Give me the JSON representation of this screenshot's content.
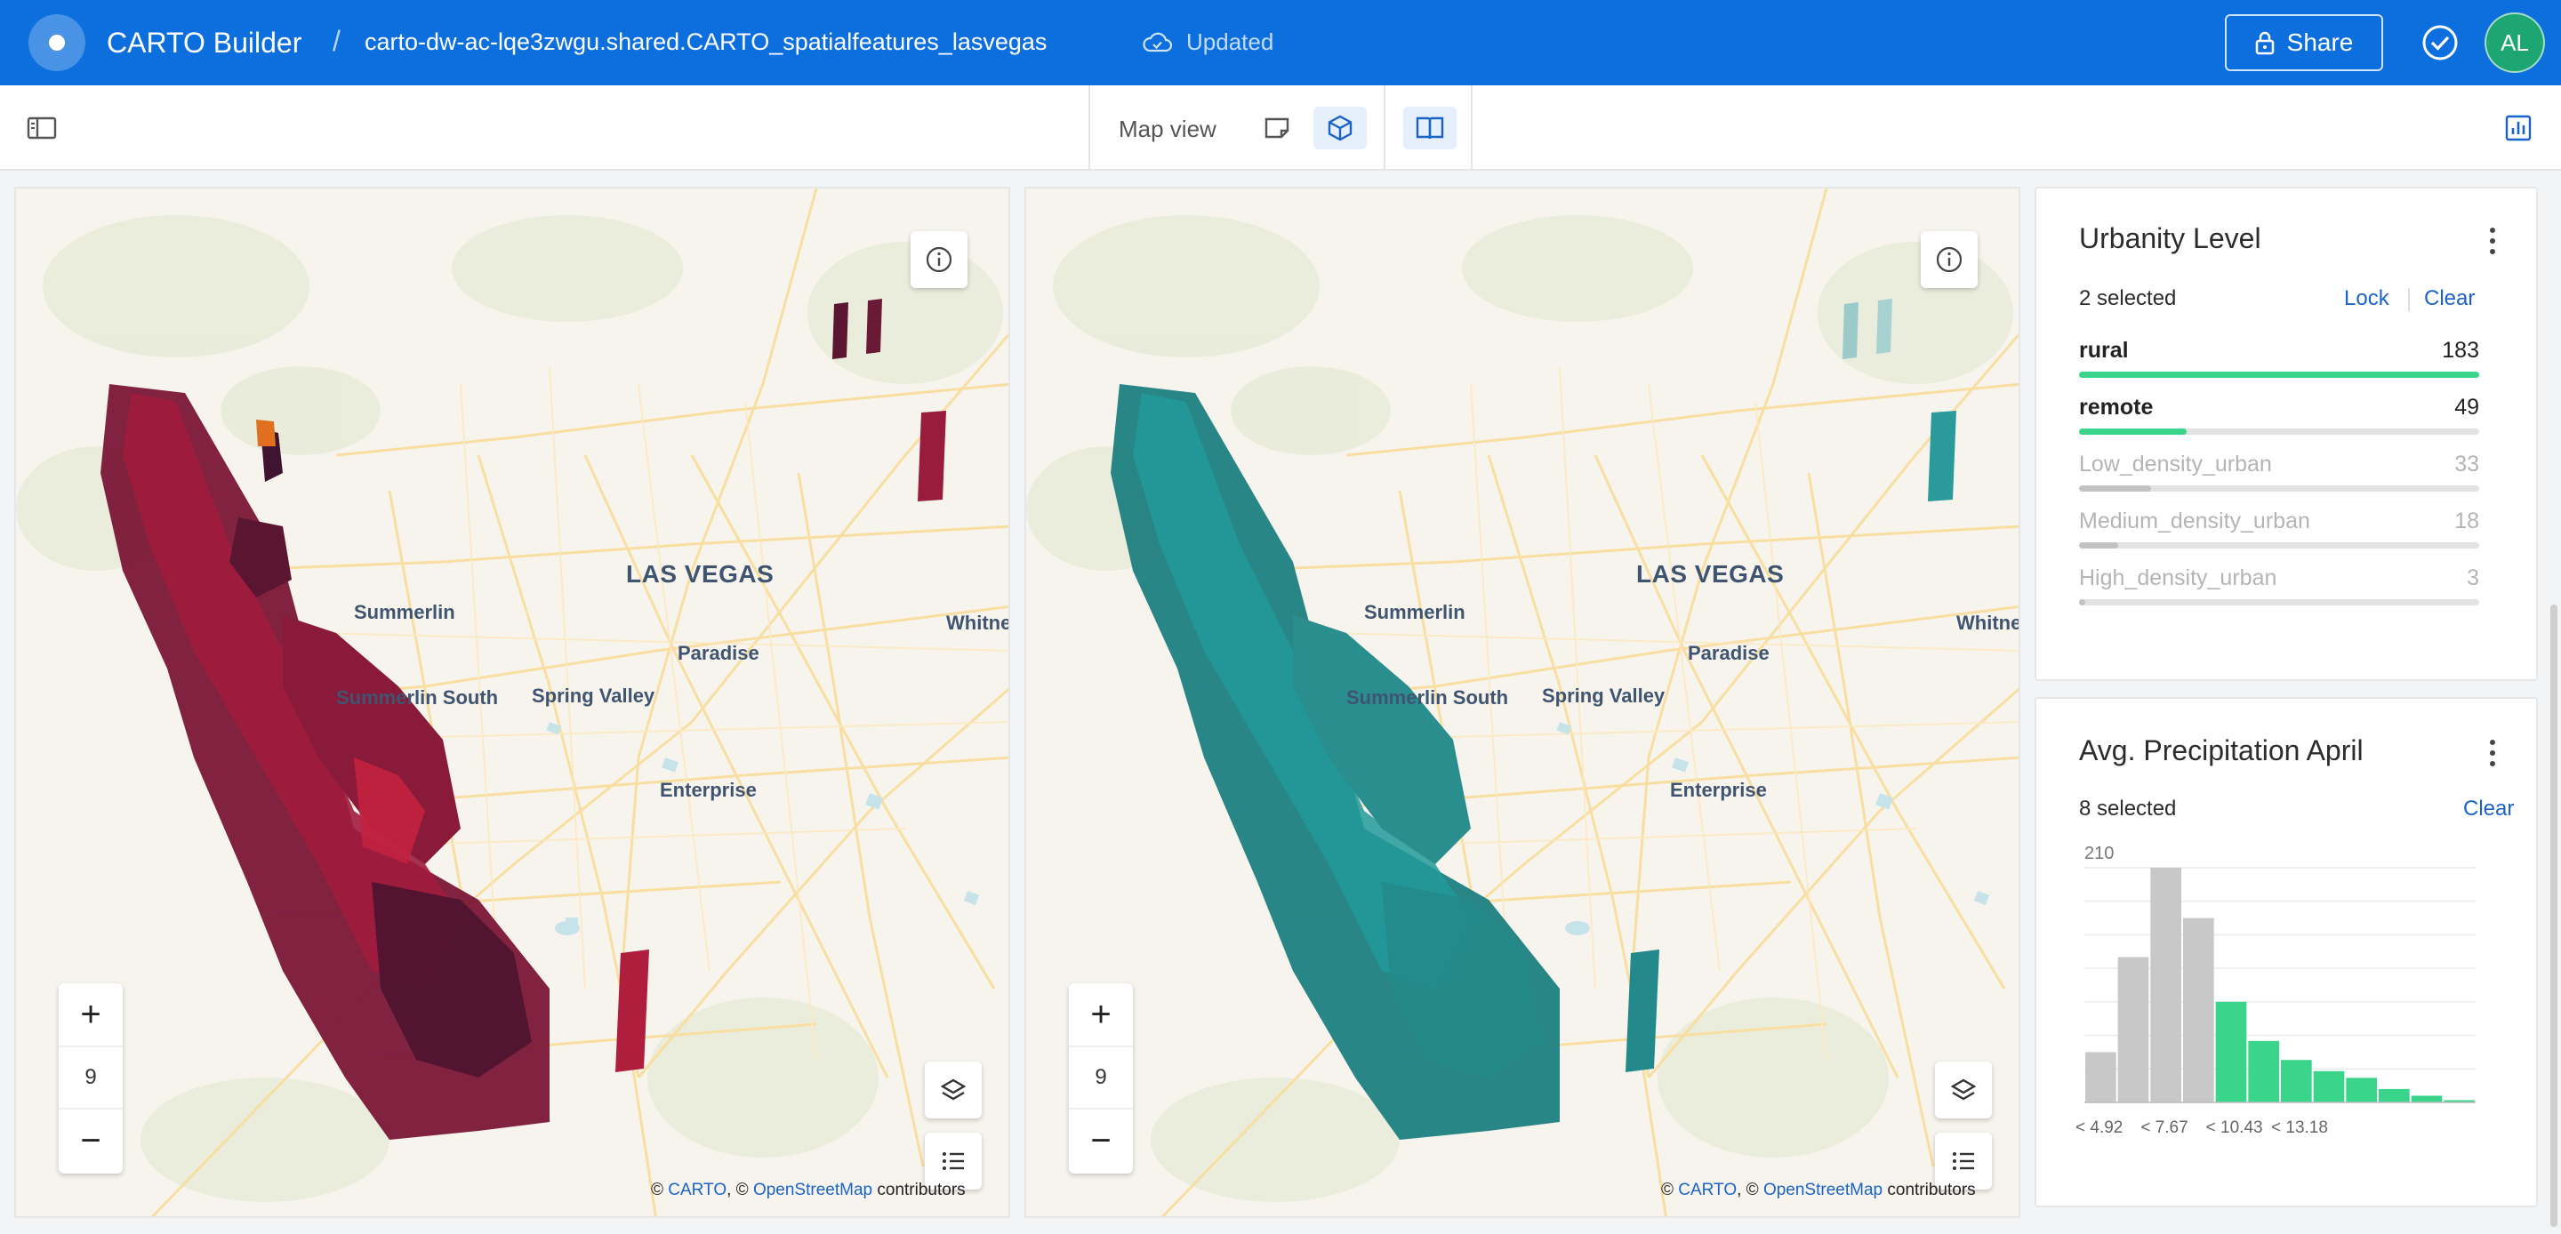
{
  "header": {
    "app_title": "CARTO Builder",
    "separator": "/",
    "dataset": "carto-dw-ac-lqe3zwgu.shared.CARTO_spatialfeatures_lasvegas",
    "status": "Updated",
    "share_label": "Share",
    "avatar_initials": "AL"
  },
  "toolbar": {
    "map_view_label": "Map view"
  },
  "map_labels": {
    "city": "LAS VEGAS",
    "summerlin": "Summerlin",
    "paradise": "Paradise",
    "summerlin_south": "Summerlin South",
    "spring_valley": "Spring Valley",
    "enterprise": "Enterprise",
    "whitney": "Whitne"
  },
  "map_left": {
    "zoom_level": "9",
    "extrusion_color": "#8c1a3c"
  },
  "map_right": {
    "zoom_level": "9",
    "extrusion_color": "#1c8c8c"
  },
  "attribution": {
    "copyright": "©",
    "carto": "CARTO",
    "comma": ", ©",
    "osm": "OpenStreetMap",
    "contributors": "contributors"
  },
  "urbanity_widget": {
    "title": "Urbanity Level",
    "selected_text": "2 selected",
    "lock_label": "Lock",
    "clear_label": "Clear",
    "categories": [
      {
        "name": "rural",
        "value": "183",
        "fraction": 1.0,
        "selected": true
      },
      {
        "name": "remote",
        "value": "49",
        "fraction": 0.268,
        "selected": true
      },
      {
        "name": "Low_density_urban",
        "value": "33",
        "fraction": 0.18,
        "selected": false
      },
      {
        "name": "Medium_density_urban",
        "value": "18",
        "fraction": 0.098,
        "selected": false
      },
      {
        "name": "High_density_urban",
        "value": "3",
        "fraction": 0.016,
        "selected": false
      }
    ],
    "selected_color": "#3ad48a",
    "unselected_color": "#c2c2c2"
  },
  "precip_widget": {
    "title": "Avg. Precipitation April",
    "selected_text": "8 selected",
    "clear_label": "Clear"
  },
  "chart_data": {
    "type": "bar",
    "title": "Avg. Precipitation April",
    "ymax_label": "210",
    "ylim": [
      0,
      210
    ],
    "x_tick_labels": [
      "< 4.92",
      "< 7.67",
      "< 10.43",
      "< 13.18"
    ],
    "values": [
      45,
      130,
      210,
      165,
      90,
      55,
      38,
      28,
      22,
      12,
      6,
      2
    ],
    "selected": [
      false,
      false,
      false,
      false,
      true,
      true,
      true,
      true,
      true,
      true,
      true,
      true
    ],
    "selected_color": "#3ad48a",
    "unselected_color": "#c8c8c8"
  }
}
